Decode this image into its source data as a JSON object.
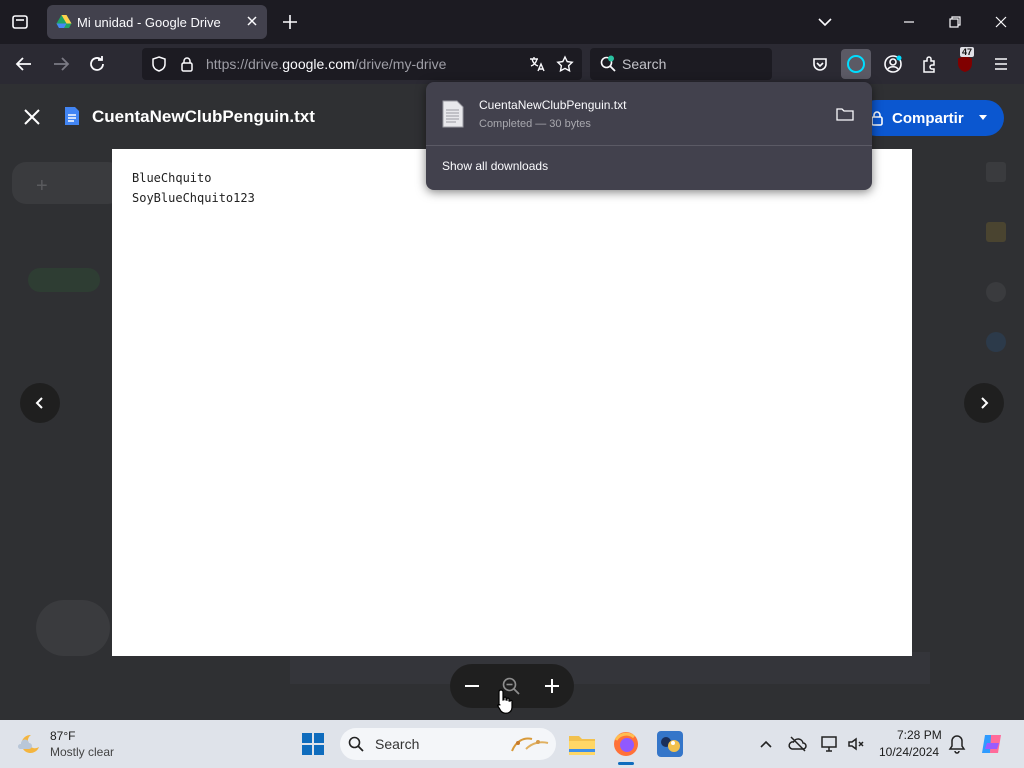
{
  "browser": {
    "tab_title": "Mi unidad - Google Drive",
    "url_prefix": "https://drive.",
    "url_domain": "google.com",
    "url_path": "/drive/my-drive",
    "search_placeholder": "Search",
    "extension_badge": "47"
  },
  "viewer": {
    "file_name": "CuentaNewClubPenguin.txt",
    "share_label": "Compartir",
    "content_lines": [
      "BlueChquito",
      "SoyBlueChquito123"
    ]
  },
  "downloads": {
    "file_name": "CuentaNewClubPenguin.txt",
    "status": "Completed — 30 bytes",
    "show_all_label": "Show all downloads"
  },
  "taskbar": {
    "temperature": "87°F",
    "weather": "Mostly clear",
    "search_label": "Search",
    "time": "7:28 PM",
    "date": "10/24/2024"
  },
  "colors": {
    "accent": "#0b57d0",
    "browser_dark": "#1c1b22",
    "panel": "#42414d"
  }
}
